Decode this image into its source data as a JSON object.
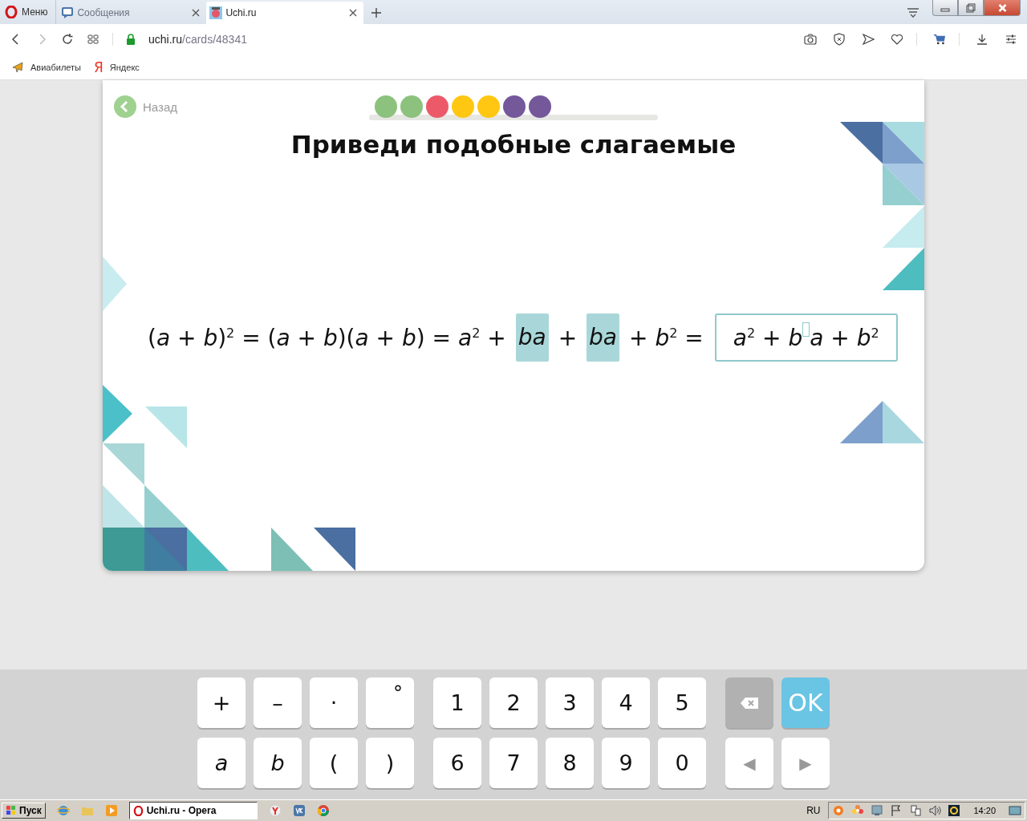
{
  "browser": {
    "menu_label": "Меню",
    "tabs": [
      {
        "label": "Сообщения",
        "selected": false
      },
      {
        "label": "Uchi.ru",
        "selected": true
      }
    ],
    "address": {
      "domain": "uchi.ru",
      "path": "/cards/48341"
    },
    "bookmarks": [
      {
        "label": "Авиабилеты",
        "kind": "plane"
      },
      {
        "label": "Яндекс",
        "kind": "letter",
        "glyph": "Я"
      }
    ]
  },
  "lesson": {
    "back_label": "Назад",
    "progress": [
      {
        "color": "#8dc17e"
      },
      {
        "color": "#8dc17e"
      },
      {
        "color": "#ec5a6a"
      },
      {
        "color": "#ffc712"
      },
      {
        "color": "#ffc712"
      },
      {
        "color": "#74589a"
      },
      {
        "color": "#74589a"
      }
    ],
    "title": "Приведи подобные слагаемые",
    "equation": [
      {
        "kind": "text",
        "text": "(*a* + *b*)$^{2}$ = (*a* + *b*)(*a* + *b*) = *a*$^{2}$ +"
      },
      {
        "kind": "highlight",
        "text": "ba"
      },
      {
        "kind": "text",
        "text": "+"
      },
      {
        "kind": "highlight",
        "text": "ba"
      },
      {
        "kind": "text",
        "text": "+ *b*$^{2}$ ="
      }
    ],
    "answer": {
      "before_cursor": "*a*$^{2}$ + *b*",
      "after_cursor": "*a* + *b*$^{2}$"
    }
  },
  "keyboard": {
    "rows": [
      {
        "groups": [
          [
            {
              "kind": "symbol",
              "label": "+"
            },
            {
              "kind": "symbol",
              "label": "–"
            },
            {
              "kind": "symbol",
              "label": "·"
            },
            {
              "kind": "raised",
              "label": "°"
            }
          ],
          [
            {
              "kind": "symbol",
              "label": "1"
            },
            {
              "kind": "symbol",
              "label": "2"
            },
            {
              "kind": "symbol",
              "label": "3"
            },
            {
              "kind": "symbol",
              "label": "4"
            },
            {
              "kind": "symbol",
              "label": "5"
            }
          ],
          [
            {
              "kind": "backspace"
            },
            {
              "kind": "ok",
              "label": "OK"
            }
          ]
        ]
      },
      {
        "groups": [
          [
            {
              "kind": "variable",
              "label": "a"
            },
            {
              "kind": "variable",
              "label": "b"
            },
            {
              "kind": "symbol",
              "label": "("
            },
            {
              "kind": "symbol",
              "label": ")"
            }
          ],
          [
            {
              "kind": "symbol",
              "label": "6"
            },
            {
              "kind": "symbol",
              "label": "7"
            },
            {
              "kind": "symbol",
              "label": "8"
            },
            {
              "kind": "symbol",
              "label": "9"
            },
            {
              "kind": "symbol",
              "label": "0"
            }
          ],
          [
            {
              "kind": "arrow",
              "label": "◀"
            },
            {
              "kind": "arrow",
              "label": "▶"
            }
          ]
        ]
      }
    ]
  },
  "taskbar": {
    "start_label": "Пуск",
    "task_label": "Uchi.ru - Opera",
    "language": "RU",
    "time": "14:20"
  }
}
